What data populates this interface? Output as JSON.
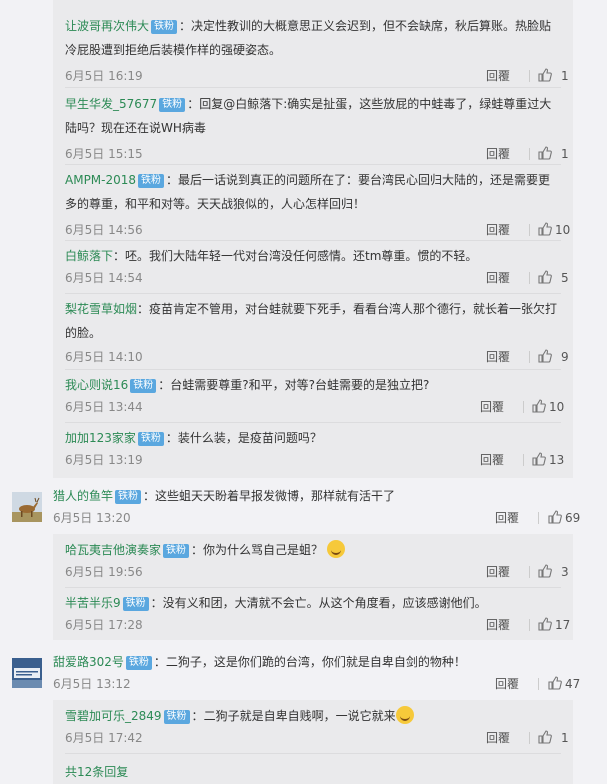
{
  "labels": {
    "badge": "铁粉",
    "reply": "回覆"
  },
  "thread1": [
    {
      "user": "让波哥再次伟大",
      "sep": "：",
      "text": "决定性教训的大概意思正义会迟到，但不会缺席，秋后算账。热脸贴冷屁股遭到拒绝后装模作样的强硬姿态。",
      "time": "6月5日 16:19",
      "likes": "1"
    },
    {
      "user": "早生华发_57677",
      "sep": "：",
      "text": "回复@白鲸落下:确实是扯蛋，这些放屁的中蛙毒了，绿蛙尊重过大陆吗？现在还在说WH病毒",
      "time": "6月5日 15:15",
      "likes": "1"
    },
    {
      "user": "AMPM-2018",
      "sep": "：",
      "text": "最后一话说到真正的问题所在了：要台湾民心回归大陆的，还是需要更多的尊重，和平和对等。天天战狼似的，人心怎样回归！",
      "time": "6月5日 14:56",
      "likes": "10"
    },
    {
      "user": "白鲸落下",
      "sep": "：",
      "text": "呸。我们大陆年轻一代对台湾没任何感情。还tm尊重。惯的不轻。",
      "time": "6月5日 14:54",
      "likes": "5"
    },
    {
      "user": "梨花雪草如烟",
      "sep": "：",
      "text": "疫苗肯定不管用，对台蛙就要下死手，看看台湾人那个德行，就长着一张欠打的脸。",
      "time": "6月5日 14:10",
      "likes": "9"
    },
    {
      "user": "我心则说16",
      "sep": "：",
      "text": "台蛙需要尊重?和平，对等?台蛙需要的是独立把?",
      "time": "6月5日 13:44",
      "likes": "10"
    },
    {
      "user": "加加123家家",
      "sep": "：",
      "text": "装什么装，是疫苗问题吗？",
      "time": "6月5日 13:19",
      "likes": "13"
    }
  ],
  "entry2": {
    "user": "猎人的鱼竿",
    "sep": "：",
    "text": "这些蛆天天盼着早报发微博，那样就有活干了",
    "time": "6月5日 13:20",
    "likes": "69"
  },
  "thread2": [
    {
      "user": "哈瓦夷吉他演奏家",
      "sep": "：",
      "text": "你为什么骂自己是蛆？",
      "time": "6月5日 19:56",
      "likes": "3"
    },
    {
      "user": "半苦半乐9",
      "sep": "：",
      "text": "没有义和团，大清就不会亡。从这个角度看，应该感谢他们。",
      "time": "6月5日 17:28",
      "likes": "17"
    }
  ],
  "entry3": {
    "user": "甜爱路302号",
    "sep": "：",
    "text": "二狗子，这是你们跪的台湾，你们就是自卑自剑的物种！",
    "time": "6月5日 13:12",
    "likes": "47"
  },
  "thread3": [
    {
      "user": "雪碧加可乐_2849",
      "sep": "：",
      "text": "二狗子就是自卑自贱啊，一说它就来",
      "time": "6月5日 17:42",
      "likes": "1"
    }
  ],
  "more_replies": "共12条回复",
  "icons": {
    "like": "thumbs-up-icon",
    "emoji_1": "smiling-face-icon",
    "emoji_2": "laughing-face-icon"
  },
  "colors": {
    "username": "#2c8a55",
    "badge": "#5aa7df",
    "panel": "#eaeaec",
    "background": "#f2f2f5"
  }
}
